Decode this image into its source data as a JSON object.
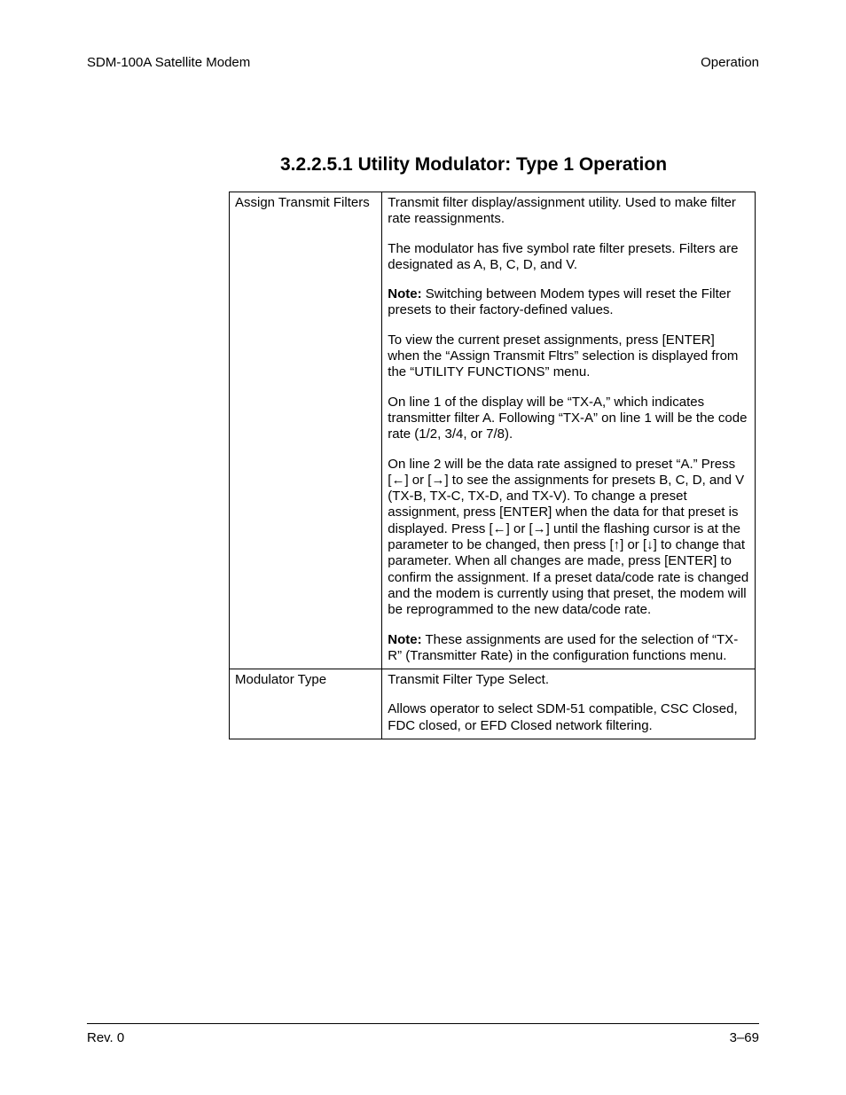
{
  "header": {
    "left": "SDM-100A Satellite Modem",
    "right": "Operation"
  },
  "heading": "3.2.2.5.1  Utility Modulator: Type 1 Operation",
  "rows": [
    {
      "label": "Assign Transmit Filters",
      "paras": [
        {
          "note": false,
          "text": "Transmit filter display/assignment utility. Used to make filter rate reassignments."
        },
        {
          "note": false,
          "text": "The modulator has five symbol rate filter presets. Filters are designated as A, B, C, D, and V."
        },
        {
          "note": true,
          "text": "Switching between Modem types will reset the Filter presets to their factory-defined values."
        },
        {
          "note": false,
          "text": "To view the current preset assignments, press [ENTER] when the “Assign Transmit Fltrs” selection is displayed from the “UTILITY FUNCTIONS” menu."
        },
        {
          "note": false,
          "text": "On line 1 of the display will be “TX-A,” which indicates transmitter filter A. Following “TX-A” on line 1 will be the code rate (1/2, 3/4, or 7/8)."
        },
        {
          "note": false,
          "text": "On line 2 will be the data rate assigned to preset “A.” Press [←] or [→] to see the assignments for presets B, C, D, and V (TX-B, TX-C, TX-D, and TX-V). To change a preset assignment, press [ENTER] when the data for that preset is displayed. Press [←] or [→] until the flashing cursor is at the parameter to be changed, then press [↑] or [↓] to change that parameter. When all changes are made, press [ENTER] to confirm the assignment. If a preset data/code rate is changed and the modem is currently using that preset, the modem will be reprogrammed to the new data/code rate."
        },
        {
          "note": true,
          "text": "These assignments are used for the selection of “TX-R” (Transmitter Rate) in the configuration functions menu."
        }
      ]
    },
    {
      "label": "Modulator Type",
      "paras": [
        {
          "note": false,
          "text": "Transmit Filter Type Select."
        },
        {
          "note": false,
          "text": "Allows operator to select SDM-51 compatible, CSC Closed, FDC closed, or EFD Closed network filtering."
        }
      ]
    }
  ],
  "footer": {
    "left": "Rev. 0",
    "right": "3–69"
  },
  "note_label": "Note:"
}
